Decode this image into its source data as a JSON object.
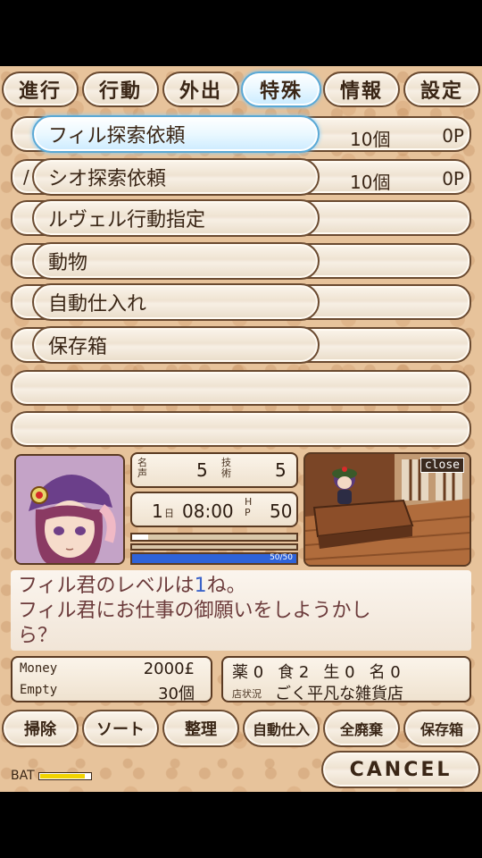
{
  "tabs": [
    "進行",
    "行動",
    "外出",
    "特殊",
    "情報",
    "設定"
  ],
  "menu": [
    {
      "label": "フィル探索依頼",
      "qty": "10個",
      "pts": "0P"
    },
    {
      "label": "シオ探索依頼",
      "qty": "10個",
      "pts": "0P"
    },
    {
      "label": "ルヴェル行動指定",
      "qty": "",
      "pts": ""
    },
    {
      "label": "動物",
      "qty": "",
      "pts": ""
    },
    {
      "label": "自動仕入れ",
      "qty": "",
      "pts": ""
    },
    {
      "label": "保存箱",
      "qty": "",
      "pts": ""
    }
  ],
  "row_left_chars": [
    "",
    "/",
    "",
    "",
    "",
    "",
    "",
    ""
  ],
  "status": {
    "fame_label": "名声",
    "fame_value": "5",
    "skill_label": "技術",
    "skill_value": "5",
    "day": "1",
    "day_unit": "日",
    "time": "08:00",
    "hp_label": "HP",
    "hp_value": "50",
    "hp_bar": "50/50"
  },
  "scene": {
    "close_label": "close"
  },
  "dialog": {
    "line1_a": "フィル君のレベルは",
    "line1_num": "1",
    "line1_b": "ね。",
    "line2": "フィル君にお仕事の御願いをしようかし",
    "line3": "ら？"
  },
  "money": {
    "money_label": "Money",
    "money_value": "2000£",
    "empty_label": "Empty",
    "empty_value": "30個"
  },
  "inventory": {
    "items": [
      {
        "label": "薬",
        "value": "0"
      },
      {
        "label": "食",
        "value": "2"
      },
      {
        "label": "生",
        "value": "0"
      },
      {
        "label": "名",
        "value": "0"
      }
    ],
    "shop_label": "店状況",
    "shop_value": "ごく平凡な雑貨店"
  },
  "actions": [
    "掃除",
    "ソート",
    "整理",
    "自動仕入",
    "全廃棄",
    "保存箱"
  ],
  "cancel_label": "CANCEL",
  "battery": {
    "label": "BAT",
    "level": 0.9
  },
  "colors": {
    "active_tab": "#5aa9d6",
    "hp_bar": "#2f63d8",
    "level_num": "#3b63c9"
  }
}
